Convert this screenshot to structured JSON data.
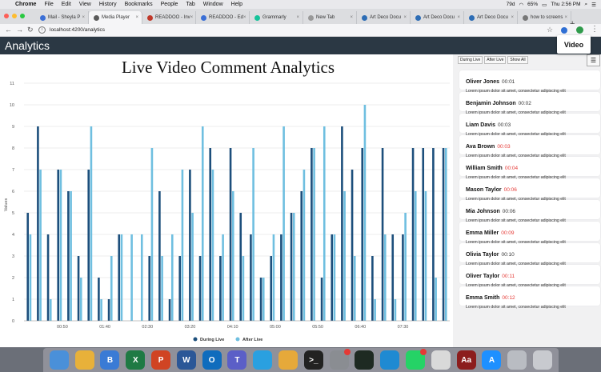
{
  "menubar": {
    "app": "Chrome",
    "items": [
      "File",
      "Edit",
      "View",
      "History",
      "Bookmarks",
      "People",
      "Tab",
      "Window",
      "Help"
    ],
    "battery": "65%",
    "clock": "Thu 2:56 PM",
    "temp": "79d"
  },
  "tabs": [
    {
      "label": "Mail - Sheyla P",
      "color": "#3b6fd6"
    },
    {
      "label": "Media Player",
      "color": "#5a5a5a"
    },
    {
      "label": "READDOO - Inv",
      "color": "#c0392b"
    },
    {
      "label": "READDOO - Ed",
      "color": "#3b6fd6"
    },
    {
      "label": "Grammarly",
      "color": "#15c39a"
    },
    {
      "label": "New Tab",
      "color": "#999999"
    },
    {
      "label": "Art Deco Docu",
      "color": "#2d6db5"
    },
    {
      "label": "Art Deco Docu",
      "color": "#2d6db5"
    },
    {
      "label": "Art Deco Docu",
      "color": "#2d6db5"
    },
    {
      "label": "how to screens",
      "color": "#777777"
    }
  ],
  "address": {
    "url": "localhost:4200/analytics"
  },
  "app": {
    "title": "Analytics",
    "video_button": "Video"
  },
  "chart_data": {
    "type": "bar",
    "title": "Live Video Comment Analytics",
    "ylabel": "Values",
    "xlabel": "",
    "ylim": [
      0,
      11
    ],
    "yticks": [
      "0",
      "1",
      "2",
      "3",
      "4",
      "5",
      "6",
      "7",
      "8",
      "9",
      "10",
      "11"
    ],
    "xtick_labels": [
      "00:50",
      "01:40",
      "02:30",
      "03:20",
      "04:10",
      "05:00",
      "05:50",
      "06:40",
      "07:30"
    ],
    "series": [
      {
        "name": "During Live",
        "color": "#1d4f7c",
        "values": [
          5,
          9,
          4,
          7,
          6,
          3,
          7,
          2,
          1,
          4,
          0,
          0,
          3,
          6,
          1,
          3,
          7,
          3,
          8,
          3,
          8,
          5,
          4,
          2,
          3,
          4,
          5,
          6,
          8,
          2,
          4,
          9,
          7,
          8,
          3,
          8,
          4,
          4,
          8,
          8,
          8,
          8
        ]
      },
      {
        "name": "After Live",
        "color": "#6fbfe0",
        "values": [
          4,
          7,
          1,
          7,
          6,
          2,
          9,
          1,
          3,
          4,
          4,
          4,
          8,
          3,
          4,
          7,
          5,
          9,
          7,
          4,
          6,
          3,
          8,
          2,
          4,
          9,
          5,
          7,
          8,
          9,
          4,
          6,
          3,
          10,
          1,
          4,
          1,
          5,
          6,
          6,
          2,
          8
        ]
      }
    ],
    "legend": "bottom"
  },
  "sidebar": {
    "filters": [
      "During Live",
      "After Live",
      "Show All"
    ],
    "comments": [
      {
        "name": "Oliver Jones",
        "time": "00:01",
        "time_color": "#333333",
        "body": "Lorem ipsum dolor sit amet, consectetur adipiscing elit"
      },
      {
        "name": "Benjamin Johnson",
        "time": "00:02",
        "time_color": "#333333",
        "body": "Lorem ipsum dolor sit amet, consectetur adipiscing elit"
      },
      {
        "name": "Liam Davis",
        "time": "00:03",
        "time_color": "#333333",
        "body": "Lorem ipsum dolor sit amet, consectetur adipiscing elit"
      },
      {
        "name": "Ava Brown",
        "time": "00:03",
        "time_color": "#e53935",
        "body": "Lorem ipsum dolor sit amet, consectetur adipiscing elit"
      },
      {
        "name": "William Smith",
        "time": "00:04",
        "time_color": "#e53935",
        "body": "Lorem ipsum dolor sit amet, consectetur adipiscing elit"
      },
      {
        "name": "Mason Taylor",
        "time": "00:06",
        "time_color": "#e53935",
        "body": "Lorem ipsum dolor sit amet, consectetur adipiscing elit"
      },
      {
        "name": "Mia Johnson",
        "time": "00:06",
        "time_color": "#333333",
        "body": "Lorem ipsum dolor sit amet, consectetur adipiscing elit"
      },
      {
        "name": "Emma Miller",
        "time": "00:09",
        "time_color": "#e53935",
        "body": "Lorem ipsum dolor sit amet, consectetur adipiscing elit"
      },
      {
        "name": "Olivia Taylor",
        "time": "00:10",
        "time_color": "#333333",
        "body": "Lorem ipsum dolor sit amet, consectetur adipiscing elit"
      },
      {
        "name": "Oliver Taylor",
        "time": "00:11",
        "time_color": "#e53935",
        "body": "Lorem ipsum dolor sit amet, consectetur adipiscing elit"
      },
      {
        "name": "Emma Smith",
        "time": "00:12",
        "time_color": "#e53935",
        "body": "Lorem ipsum dolor sit amet, consectetur adipiscing elit"
      }
    ]
  },
  "dock": [
    {
      "name": "finder-icon",
      "color": "#4a90d9",
      "glyph": ""
    },
    {
      "name": "chrome-icon",
      "color": "#e8b13a",
      "glyph": ""
    },
    {
      "name": "bbedit-icon",
      "color": "#3a7bd5",
      "glyph": "B"
    },
    {
      "name": "excel-icon",
      "color": "#1f7a44",
      "glyph": "X"
    },
    {
      "name": "powerpoint-icon",
      "color": "#d04423",
      "glyph": "P"
    },
    {
      "name": "word-icon",
      "color": "#2b5797",
      "glyph": "W"
    },
    {
      "name": "outlook-icon",
      "color": "#0f6cbd",
      "glyph": "O"
    },
    {
      "name": "teams-icon",
      "color": "#5b5fc7",
      "glyph": "T"
    },
    {
      "name": "safari-icon",
      "color": "#2aa0e0",
      "glyph": ""
    },
    {
      "name": "slack-icon",
      "color": "#e6a93a",
      "glyph": ""
    },
    {
      "name": "terminal-icon",
      "color": "#222222",
      "glyph": ">_"
    },
    {
      "name": "system-preferences-icon",
      "color": "#8a8d92",
      "glyph": ""
    },
    {
      "name": "activity-monitor-icon",
      "color": "#1e2a22",
      "glyph": ""
    },
    {
      "name": "vscode-icon",
      "color": "#1f8ad2",
      "glyph": ""
    },
    {
      "name": "whatsapp-icon",
      "color": "#25d366",
      "glyph": ""
    },
    {
      "name": "textedit-icon",
      "color": "#d9d9d9",
      "glyph": ""
    },
    {
      "name": "dictionary-icon",
      "color": "#8c1d1d",
      "glyph": "Aa"
    },
    {
      "name": "app-store-icon",
      "color": "#1e90ff",
      "glyph": "A"
    },
    {
      "name": "file-manager-icon",
      "color": "#b9bcc2",
      "glyph": ""
    },
    {
      "name": "trash-icon",
      "color": "#c8cacf",
      "glyph": ""
    }
  ]
}
